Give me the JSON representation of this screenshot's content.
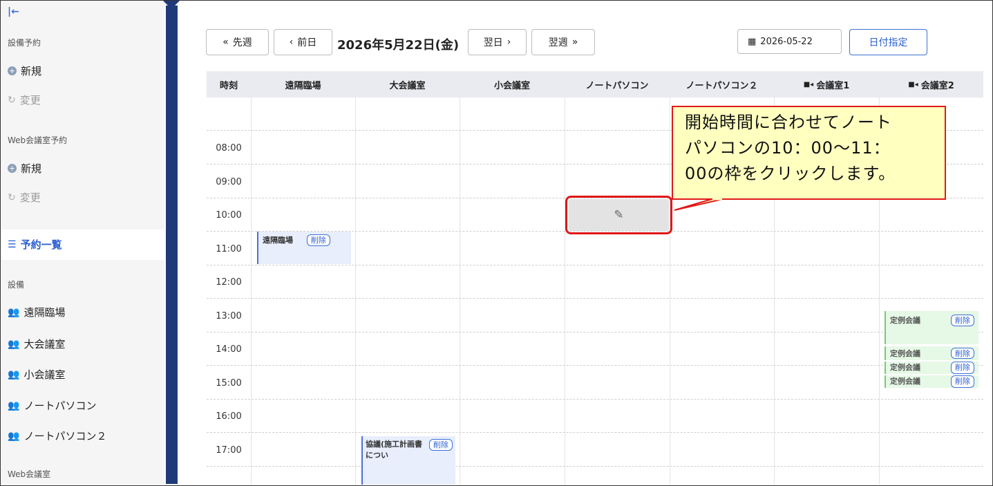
{
  "sidebar": {
    "collapse_icon": "collapse-left-icon",
    "sec_facility": "設備予約",
    "new_label": "新規",
    "change_label": "変更",
    "sec_web": "Web会議室予約",
    "new_label2": "新規",
    "change_label2": "変更",
    "list_label": "予約一覧",
    "sec_facilities": "設備",
    "facilities": [
      "遠隔臨場",
      "大会議室",
      "小会議室",
      "ノートパソコン",
      "ノートパソコン２"
    ],
    "sec_webrooms": "Web会議室"
  },
  "toolbar": {
    "prev_week": "先週",
    "prev_day": "前日",
    "date_title": "2026年5月22日(金)",
    "next_day": "翌日",
    "next_week": "翌週",
    "date_value": "2026-05-22",
    "date_specify": "日付指定"
  },
  "grid": {
    "headers": [
      "時刻",
      "遠隔臨場",
      "大会議室",
      "小会議室",
      "ノートパソコン",
      "ノートパソコン２",
      "会議室1",
      "会議室2"
    ],
    "times": [
      "08:00",
      "09:00",
      "10:00",
      "11:00",
      "12:00",
      "13:00",
      "14:00",
      "15:00",
      "16:00",
      "17:00"
    ]
  },
  "events": {
    "e1_title": "遠隔臨場",
    "e2_title": "協議(施工計画書につい",
    "e3_title": "定例会議",
    "e4_title": "定例会議",
    "e5_title": "定例会議",
    "e6_title": "定例会議",
    "delete_label": "削除"
  },
  "callout": {
    "line1": "開始時間に合わせてノート",
    "line2": "パソコンの10：00～11：",
    "line3": "00の枠をクリックします。"
  },
  "colors": {
    "accent": "#2a5fd0",
    "dark_bar": "#1f3a78",
    "callout_bg": "#ffffc0",
    "callout_border": "#e01818"
  }
}
